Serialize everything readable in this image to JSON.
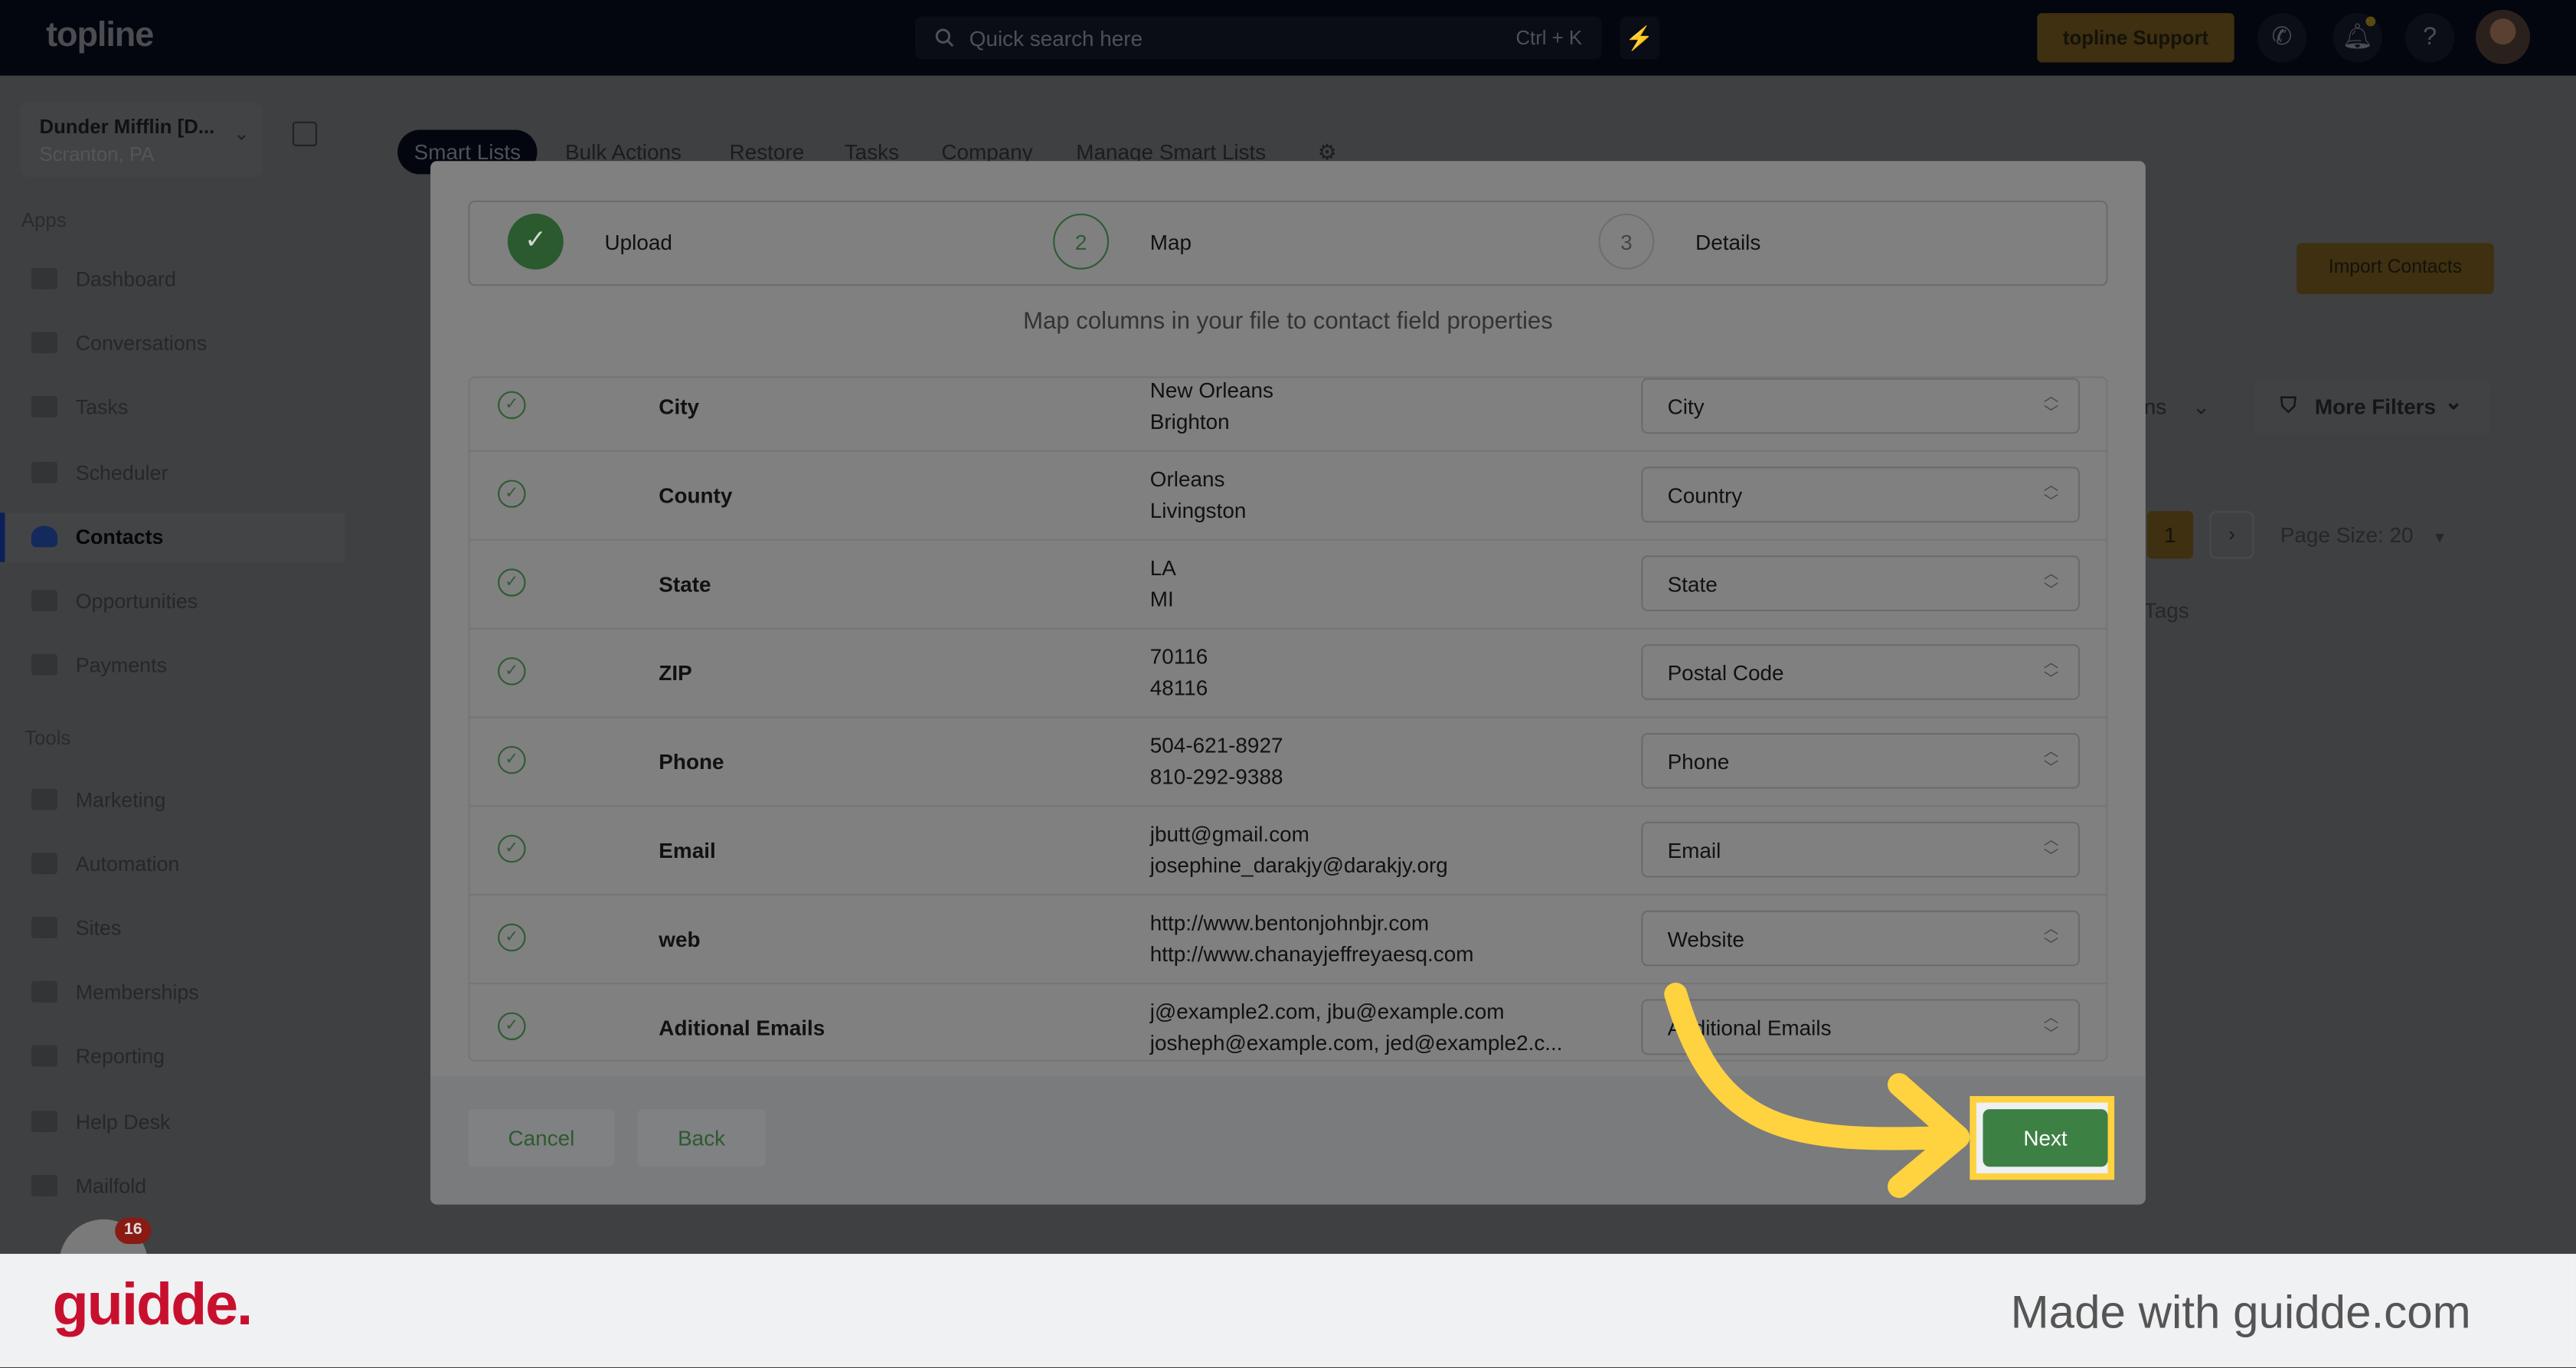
{
  "topbar": {
    "logo": "topline",
    "search_placeholder": "Quick search here",
    "search_shortcut": "Ctrl + K",
    "support_label": "topline Support",
    "bolt_icon": "lightning-icon",
    "phone_icon": "phone-icon",
    "bell_icon": "bell-icon",
    "help_label": "?"
  },
  "account": {
    "name": "Dunder Mifflin [D...",
    "location": "Scranton, PA"
  },
  "sidebar": {
    "apps_label": "Apps",
    "apps": [
      {
        "label": "Dashboard"
      },
      {
        "label": "Conversations"
      },
      {
        "label": "Tasks"
      },
      {
        "label": "Scheduler"
      },
      {
        "label": "Contacts",
        "active": true
      },
      {
        "label": "Opportunities"
      },
      {
        "label": "Payments"
      }
    ],
    "tools_label": "Tools",
    "tools": [
      {
        "label": "Marketing"
      },
      {
        "label": "Automation"
      },
      {
        "label": "Sites"
      },
      {
        "label": "Memberships"
      },
      {
        "label": "Reporting"
      },
      {
        "label": "Help Desk"
      },
      {
        "label": "Mailfold"
      }
    ],
    "notification_badge": "16"
  },
  "tabs": [
    {
      "label": "Smart Lists",
      "active": true
    },
    {
      "label": "Bulk Actions"
    },
    {
      "label": "Restore"
    },
    {
      "label": "Tasks"
    },
    {
      "label": "Company"
    },
    {
      "label": "Manage Smart Lists"
    }
  ],
  "background": {
    "import_contacts": "Import Contacts",
    "columns_partial": "ns",
    "more_filters": "More Filters",
    "page_current": "1",
    "page_size": "Page Size: 20",
    "tags_header": "Tags"
  },
  "modal": {
    "steps": [
      {
        "number": "1",
        "label": "Upload",
        "state": "complete"
      },
      {
        "number": "2",
        "label": "Map",
        "state": "current"
      },
      {
        "number": "3",
        "label": "Details",
        "state": "pending"
      }
    ],
    "subtitle": "Map columns in your file to contact field properties",
    "rows": [
      {
        "column": "City",
        "samples": [
          "New Orleans",
          "Brighton"
        ],
        "field": "City"
      },
      {
        "column": "County",
        "samples": [
          "Orleans",
          "Livingston"
        ],
        "field": "Country"
      },
      {
        "column": "State",
        "samples": [
          "LA",
          "MI"
        ],
        "field": "State"
      },
      {
        "column": "ZIP",
        "samples": [
          "70116",
          "48116"
        ],
        "field": "Postal Code"
      },
      {
        "column": "Phone",
        "samples": [
          "504-621-8927",
          "810-292-9388"
        ],
        "field": "Phone"
      },
      {
        "column": "Email",
        "samples": [
          "jbutt@gmail.com",
          "josephine_darakjy@darakjy.org"
        ],
        "field": "Email"
      },
      {
        "column": "web",
        "samples": [
          "http://www.bentonjohnbjr.com",
          "http://www.chanayjeffreyaesq.com"
        ],
        "field": "Website"
      },
      {
        "column": "Aditional Emails",
        "samples": [
          "j@example2.com, jbu@example.com",
          "josheph@example.com, jed@example2.c..."
        ],
        "field": "Additional Emails"
      }
    ],
    "cancel_label": "Cancel",
    "back_label": "Back",
    "next_label": "Next"
  },
  "colors": {
    "accent_green": "#3d8044",
    "highlight_yellow": "#ffd23f",
    "brand_red": "#c8102e"
  },
  "watermark": {
    "logo": "guidde.",
    "made_with": "Made with guidde.com"
  }
}
